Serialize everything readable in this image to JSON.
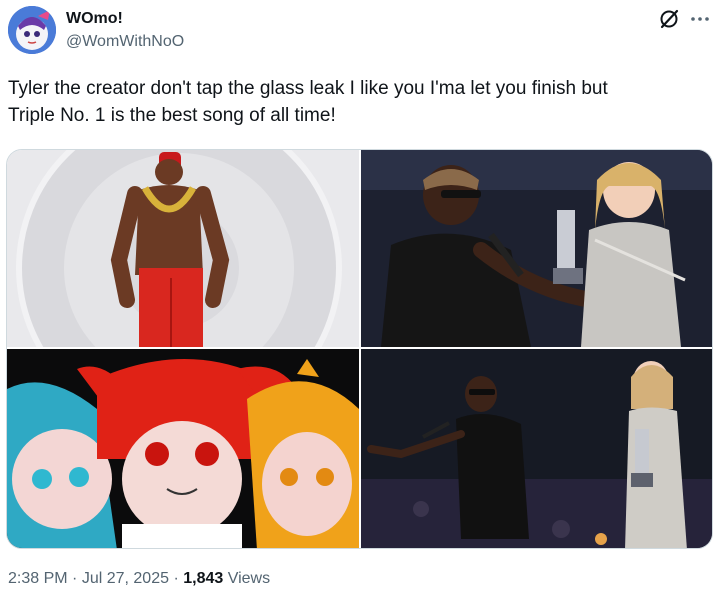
{
  "author": {
    "display_name": "WOmo!",
    "handle": "@WomWithNoO",
    "avatar_icon": "anime-avatar"
  },
  "header_icons": {
    "grok": "grok-icon",
    "more": "more-dots-icon"
  },
  "tweet": {
    "text": "Tyler the creator don't tap the glass leak I like you I'ma let you finish but\nTriple No. 1 is the best song of all time!"
  },
  "media": [
    {
      "label": "shirtless-man-gold-chain-red-pants-photo"
    },
    {
      "label": "man-taking-microphone-on-stage-photo"
    },
    {
      "label": "anime-three-characters-illustration"
    },
    {
      "label": "man-pointing-on-stage-photo"
    }
  ],
  "meta": {
    "time": "2:38 PM",
    "separator_1": " · ",
    "date": "Jul 27, 2025",
    "separator_2": " · ",
    "views_count": "1,843",
    "views_label": " Views"
  },
  "colors": {
    "text_primary": "#0f1419",
    "text_secondary": "#536471",
    "border": "#cfd9de"
  }
}
